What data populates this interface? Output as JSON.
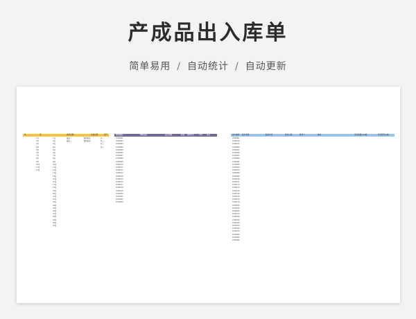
{
  "page": {
    "title": "产成品出入库单",
    "subtitle_items": [
      "简单易用",
      "自动统计",
      "自动更新"
    ]
  },
  "colors": {
    "yellow_header": "#f4c542",
    "purple_header": "#6d6a96",
    "blue_header": "#9cc3ea"
  },
  "sheet": {
    "yellow_table": {
      "headers": [
        "年",
        "月",
        "类型名称",
        "分账名称",
        "部门"
      ],
      "months": [
        "1月",
        "2月",
        "3月",
        "4月",
        "5月",
        "6月",
        "7月",
        "8月",
        "9月",
        "10月",
        "11月",
        "12月"
      ],
      "days": [
        "1日",
        "2日",
        "3日",
        "4日",
        "5日",
        "6日",
        "7日",
        "8日",
        "9日",
        "10日",
        "11日",
        "12日",
        "13日",
        "14日",
        "15日",
        "16日",
        "17日",
        "18日",
        "19日",
        "20日",
        "21日",
        "22日",
        "23日",
        "24日",
        "25日",
        "26日",
        "27日",
        "28日",
        "29日",
        "30日",
        "31日"
      ],
      "types": [
        "成品一",
        "成品二"
      ],
      "accounts": [
        "股份出库",
        "股份出库"
      ],
      "depts": [
        "包一",
        "包二",
        "包三",
        "包八"
      ]
    },
    "purple_table": {
      "headers": [
        "物料编码",
        "物料品名",
        "品名规格",
        "数量",
        "物料批号",
        "单价",
        "备注"
      ],
      "codes": [
        "0100001",
        "0100002",
        "0100003",
        "0100004",
        "0100005",
        "0100006",
        "0100007",
        "0100008",
        "0100009",
        "0100010",
        "0100011",
        "0100012",
        "0100013",
        "0100014",
        "0100015",
        "0100016",
        "0100017",
        "0100018",
        "0100019",
        "0100020",
        "0100021",
        "0100022",
        "0100023"
      ]
    },
    "blue_table": {
      "headers": [
        "客户编码",
        "客户名称",
        "联系方式",
        "联系日期",
        "联系人",
        "地址",
        "专营者报价价格",
        "专营部门价格"
      ],
      "codes": [
        "0100001",
        "0100010",
        "0100011",
        "0100020",
        "0100021",
        "0100030",
        "0100031",
        "0100040",
        "0100041",
        "0100050",
        "0100060",
        "0100070",
        "0100080",
        "0100090",
        "0100100",
        "0100101",
        "0100110",
        "0100120",
        "0100130",
        "0100140",
        "0100150",
        "0100160",
        "0100170",
        "0100180",
        "0100190",
        "0100200",
        "0100210",
        "0100220",
        "0100230",
        "0100240",
        "0100250",
        "0100260",
        "0100270",
        "0100280",
        "0100290",
        "0100300"
      ]
    }
  }
}
